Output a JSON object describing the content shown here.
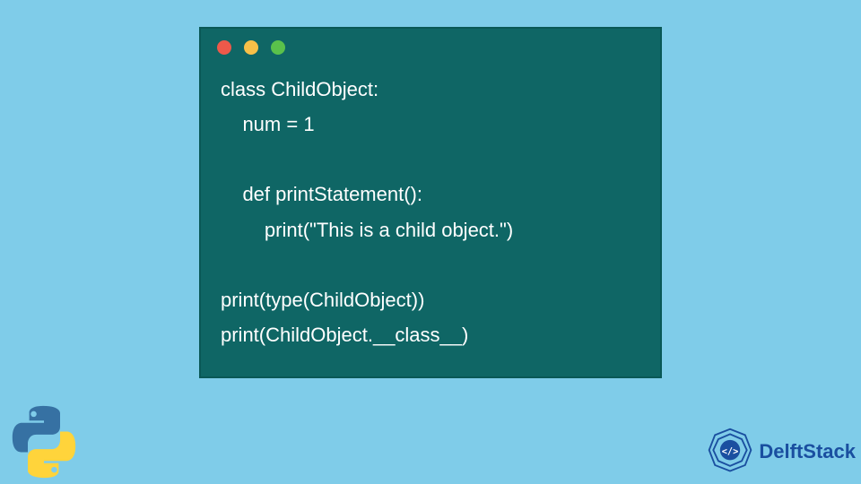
{
  "code": {
    "lines": [
      "class ChildObject:",
      "    num = 1",
      "",
      "    def printStatement():",
      "        print(\"This is a child object.\")",
      "",
      "print(type(ChildObject))",
      "print(ChildObject.__class__)"
    ]
  },
  "brand": {
    "name": "DelftStack"
  },
  "colors": {
    "background": "#7fcce9",
    "window": "#0f6665",
    "dot_red": "#ed594a",
    "dot_yellow": "#f7c048",
    "dot_green": "#5ac14b",
    "brand_blue": "#1a4fa0"
  }
}
